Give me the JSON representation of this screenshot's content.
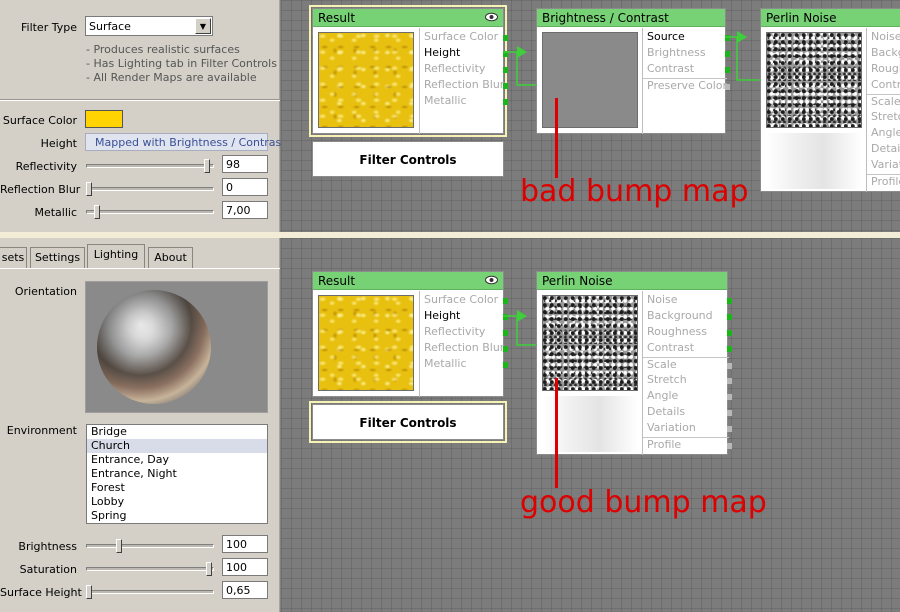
{
  "top_panel": {
    "filter_type_label": "Filter Type",
    "filter_type_value": "Surface",
    "notes": [
      "- Produces realistic surfaces",
      "- Has Lighting tab in Filter Controls",
      "- All Render Maps are available"
    ],
    "surface_color_label": "Surface Color",
    "surface_color": "#ffd400",
    "height_label": "Height",
    "height_value": "Mapped with Brightness / Contrast",
    "reflectivity_label": "Reflectivity",
    "reflectivity_value": "98",
    "reflectivity_fraction": 0.98,
    "reflection_blur_label": "Reflection Blur",
    "reflection_blur_value": "0",
    "reflection_blur_fraction": 0.0,
    "metallic_label": "Metallic",
    "metallic_value": "7,00",
    "metallic_fraction": 0.07
  },
  "bottom_panel": {
    "tabs": [
      {
        "label": "sets",
        "active": false
      },
      {
        "label": "Settings",
        "active": false
      },
      {
        "label": "Lighting",
        "active": true
      },
      {
        "label": "About",
        "active": false
      }
    ],
    "orientation_label": "Orientation",
    "environment_label": "Environment",
    "environments": [
      "Bridge",
      "Church",
      "Entrance, Day",
      "Entrance, Night",
      "Forest",
      "Lobby",
      "Spring"
    ],
    "selected_environment": "Church",
    "brightness_label": "Brightness",
    "brightness_value": "100",
    "brightness_fraction": 0.25,
    "saturation_label": "Saturation",
    "saturation_value": "100",
    "saturation_fraction": 1.0,
    "surface_height_label": "Surface Height",
    "surface_height_value": "0,65",
    "surface_height_fraction": 0.0
  },
  "top_canvas": {
    "result_node": {
      "title": "Result",
      "ports": [
        {
          "label": "Surface Color",
          "connected": false
        },
        {
          "label": "Height",
          "connected": true
        },
        {
          "label": "Reflectivity",
          "connected": false
        },
        {
          "label": "Reflection Blur",
          "connected": false
        },
        {
          "label": "Metallic",
          "connected": false
        }
      ]
    },
    "filter_controls_label": "Filter Controls",
    "bc_node": {
      "title": "Brightness / Contrast",
      "ports": [
        {
          "label": "Source",
          "connected": true
        },
        {
          "label": "Brightness",
          "connected": false
        },
        {
          "label": "Contrast",
          "connected": false
        },
        {
          "label": "Preserve Color",
          "connected": false
        }
      ]
    },
    "perlin_node": {
      "title": "Perlin Noise",
      "ports": [
        "Noise",
        "Backgr",
        "Rough",
        "Contra",
        "Scale",
        "Stretc",
        "Angle",
        "Details",
        "Variatio",
        "Profile"
      ]
    },
    "annotation": "bad bump map"
  },
  "bottom_canvas": {
    "result_node": {
      "title": "Result",
      "ports": [
        {
          "label": "Surface Color",
          "connected": false
        },
        {
          "label": "Height",
          "connected": true
        },
        {
          "label": "Reflectivity",
          "connected": false
        },
        {
          "label": "Reflection Blur",
          "connected": false
        },
        {
          "label": "Metallic",
          "connected": false
        }
      ]
    },
    "filter_controls_label": "Filter Controls",
    "perlin_node": {
      "title": "Perlin Noise",
      "ports": [
        "Noise",
        "Background",
        "Roughness",
        "Contrast",
        "Scale",
        "Stretch",
        "Angle",
        "Details",
        "Variation",
        "Profile"
      ]
    },
    "annotation": "good bump map"
  },
  "colors": {
    "node_header": "#77d275",
    "annotation_red": "#dd0000",
    "port_connected": "#1bb51b",
    "selection_outline": "#f7f3b4"
  },
  "icons": [
    "eye-icon",
    "dropdown-arrow-icon",
    "environment-sphere-icon"
  ]
}
